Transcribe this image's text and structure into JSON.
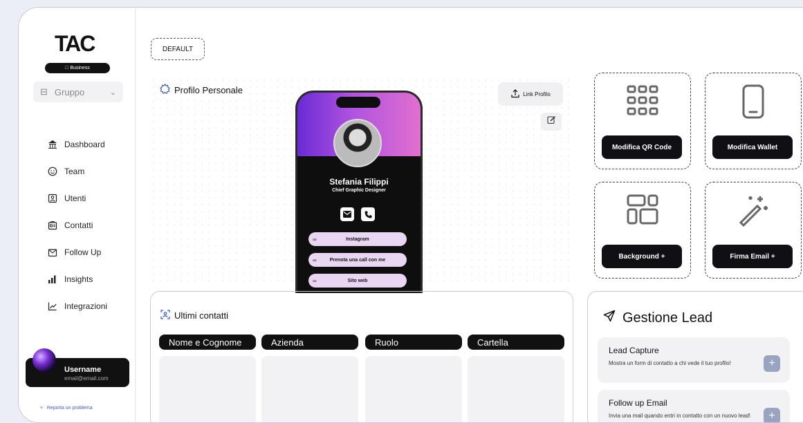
{
  "sidebar": {
    "logo": "TAC",
    "badge": "Business",
    "group": "Gruppo",
    "items": [
      {
        "label": "Dashboard",
        "icon": "bank-icon"
      },
      {
        "label": "Team",
        "icon": "smiley-icon"
      },
      {
        "label": "Utenti",
        "icon": "user-card-icon"
      },
      {
        "label": "Contatti",
        "icon": "contacts-icon"
      },
      {
        "label": "Follow Up",
        "icon": "follow-up-icon"
      },
      {
        "label": "Insights",
        "icon": "bars-icon"
      },
      {
        "label": "Integrazioni",
        "icon": "chart-icon"
      }
    ],
    "user": {
      "name": "Username",
      "email": "email@email.com"
    },
    "report": "Reporta un problema"
  },
  "main": {
    "default_label": "DEFAULT",
    "profile_title": "Profilo Personale",
    "link_profile": "Link Profilo",
    "phone": {
      "name": "Stefania Filippi",
      "title": "Chief Graphic Designer",
      "links": [
        "Instagram",
        "Prenota una call con me",
        "Sito web"
      ]
    },
    "tiles": {
      "qr": "Modifica QR Code",
      "wallet": "Modifica Wallet",
      "background": "Background +",
      "signature": "Firma Email +"
    },
    "contacts": {
      "title": "Ultimi contatti",
      "columns": [
        "Nome e Cognome",
        "Azienda",
        "Ruolo",
        "Cartella"
      ]
    },
    "lead": {
      "title": "Gestione Lead",
      "cards": [
        {
          "title": "Lead Capture",
          "desc": "Mostra un form di contatto a chi vede il tuo profilo!"
        },
        {
          "title": "Follow up Email",
          "desc": "Invia una mail quando entri in contatto con un nuovo lead!"
        }
      ]
    }
  },
  "colors": {
    "accent": "#111111",
    "border": "#c9c2ee",
    "plus": "#9aa4c1"
  }
}
